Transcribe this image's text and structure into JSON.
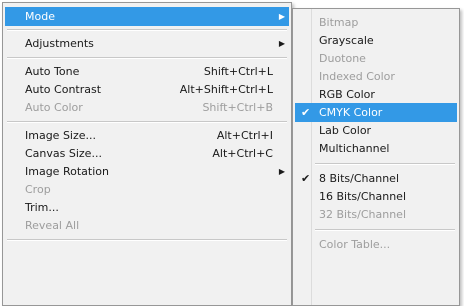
{
  "main_menu": {
    "items": [
      {
        "label": "Mode",
        "shortcut": "",
        "submenu": true,
        "state": "highlighted"
      },
      {
        "label": "Adjustments",
        "shortcut": "",
        "submenu": true,
        "state": "normal"
      },
      {
        "label": "Auto Tone",
        "shortcut": "Shift+Ctrl+L",
        "submenu": false,
        "state": "normal"
      },
      {
        "label": "Auto Contrast",
        "shortcut": "Alt+Shift+Ctrl+L",
        "submenu": false,
        "state": "normal"
      },
      {
        "label": "Auto Color",
        "shortcut": "Shift+Ctrl+B",
        "submenu": false,
        "state": "disabled"
      },
      {
        "label": "Image Size...",
        "shortcut": "Alt+Ctrl+I",
        "submenu": false,
        "state": "normal"
      },
      {
        "label": "Canvas Size...",
        "shortcut": "Alt+Ctrl+C",
        "submenu": false,
        "state": "normal"
      },
      {
        "label": "Image Rotation",
        "shortcut": "",
        "submenu": true,
        "state": "normal"
      },
      {
        "label": "Crop",
        "shortcut": "",
        "submenu": false,
        "state": "disabled"
      },
      {
        "label": "Trim...",
        "shortcut": "",
        "submenu": false,
        "state": "normal"
      },
      {
        "label": "Reveal All",
        "shortcut": "",
        "submenu": false,
        "state": "disabled"
      }
    ]
  },
  "sub_menu": {
    "items": [
      {
        "label": "Bitmap",
        "checked": false,
        "state": "disabled"
      },
      {
        "label": "Grayscale",
        "checked": false,
        "state": "normal"
      },
      {
        "label": "Duotone",
        "checked": false,
        "state": "disabled"
      },
      {
        "label": "Indexed Color",
        "checked": false,
        "state": "disabled"
      },
      {
        "label": "RGB Color",
        "checked": false,
        "state": "normal"
      },
      {
        "label": "CMYK Color",
        "checked": true,
        "state": "highlighted"
      },
      {
        "label": "Lab Color",
        "checked": false,
        "state": "normal"
      },
      {
        "label": "Multichannel",
        "checked": false,
        "state": "normal"
      },
      {
        "label": "8 Bits/Channel",
        "checked": true,
        "state": "normal"
      },
      {
        "label": "16 Bits/Channel",
        "checked": false,
        "state": "normal"
      },
      {
        "label": "32 Bits/Channel",
        "checked": false,
        "state": "disabled"
      },
      {
        "label": "Color Table...",
        "checked": false,
        "state": "disabled"
      }
    ]
  },
  "icons": {
    "submenu_arrow": "▶",
    "check": "✔"
  },
  "colors": {
    "highlight": "#3399e6",
    "disabled_text": "#9d9d9d",
    "menu_bg": "#f1f1f1"
  }
}
